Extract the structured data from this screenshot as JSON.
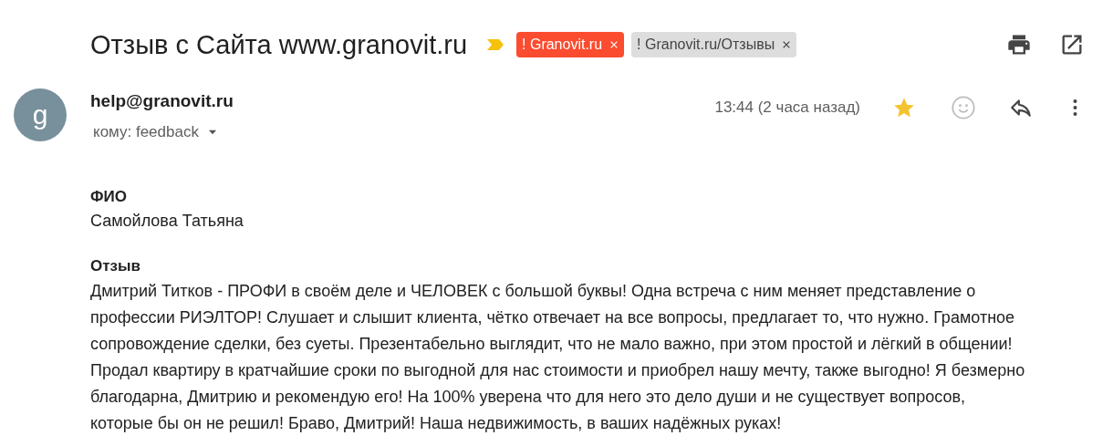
{
  "subject": "Отзыв с Сайта www.granovit.ru",
  "important": true,
  "labels": [
    {
      "text": "! Granovit.ru",
      "color": "#fb4c2f"
    },
    {
      "text": "! Granovit.ru/Отзывы",
      "color": "#dddddd"
    }
  ],
  "sender": {
    "avatar_letter": "g",
    "email": "help@granovit.ru",
    "to": "кому: feedback"
  },
  "time": "13:44 (2 часа назад)",
  "starred": true,
  "body": [
    {
      "heading": "ФИО",
      "text": "Самойлова Татьяна"
    },
    {
      "heading": "Отзыв",
      "text": "Дмитрий Титков - ПРОФИ в своём деле и ЧЕЛОВЕК с большой буквы! Одна встреча с ним меняет представление о профессии РИЭЛТОР! Слушает и слышит клиента, чётко отвечает на все вопросы, предлагает то, что нужно. Грамотное сопровождение сделки, без суеты. Презентабельно выглядит, что не мало важно, при этом простой и лёгкий в общении! Продал квартиру в кратчайшие сроки по выгодной для нас стоимости и приобрел нашу мечту, также выгодно! Я безмерно благодарна, Дмитрию и рекомендую его! На 100% уверена что для него это дело души и не существует вопросов, которые бы он не решил! Браво, Дмитрий! Наша недвижимость, в ваших надёжных руках!"
    }
  ]
}
